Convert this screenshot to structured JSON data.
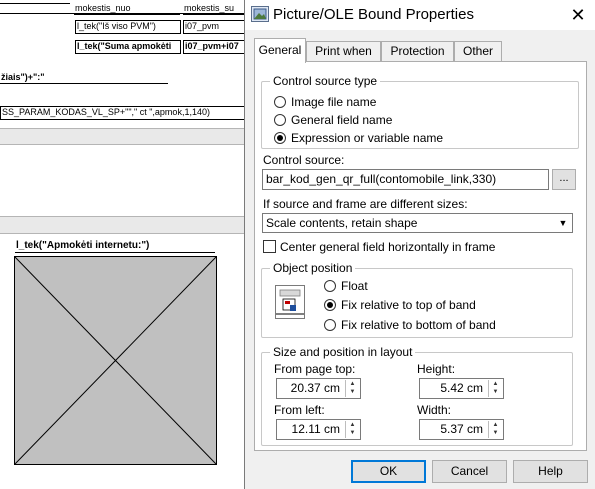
{
  "designer": {
    "col_header_1": "",
    "col_header_2": "mokestis_nuo",
    "col_header_3": "mokestis_su",
    "field_is_viso_pvm": "l_tek(\"Iš viso PVM\")",
    "field_i07_pvm": "i07_pvm",
    "field_suma_apmoketi": "l_tek(\"Suma apmokėti",
    "field_i07_pvm_sum": "i07_pvm+i07",
    "expr_ziais": "žiais\")+\":\"",
    "expr_param": "SS_PARAM_KODAS_VL_SP+\"\",\" ct \",apmok,1,140)",
    "field_apmoketi_internetu": "l_tek(\"Apmokėti internetu:\")"
  },
  "dialog": {
    "title": "Picture/OLE Bound Properties",
    "close_glyph": "✕",
    "tabs": [
      "General",
      "Print when",
      "Protection",
      "Other"
    ],
    "control_source_type": {
      "legend": "Control source type",
      "options": [
        "Image file name",
        "General field name",
        "Expression or variable name"
      ],
      "selected_index": 2
    },
    "control_source": {
      "label": "Control source:",
      "value": "bar_kod_gen_qr_full(contomobile_link,330)",
      "button": "..."
    },
    "size_mode": {
      "label": "If source and frame are different sizes:",
      "value": "Scale contents, retain shape"
    },
    "center_checkbox": {
      "label": "Center general field horizontally in frame",
      "checked": false
    },
    "object_position": {
      "legend": "Object position",
      "options": [
        "Float",
        "Fix relative to top of band",
        "Fix relative to bottom of band"
      ],
      "selected_index": 1
    },
    "size_position": {
      "legend": "Size and position in layout",
      "from_page_top_label": "From page top:",
      "from_page_top_value": "20.37 cm",
      "height_label": "Height:",
      "height_value": "5.42 cm",
      "from_left_label": "From left:",
      "from_left_value": "12.11 cm",
      "width_label": "Width:",
      "width_value": "5.37 cm"
    },
    "buttons": {
      "ok": "OK",
      "cancel": "Cancel",
      "help": "Help"
    }
  }
}
